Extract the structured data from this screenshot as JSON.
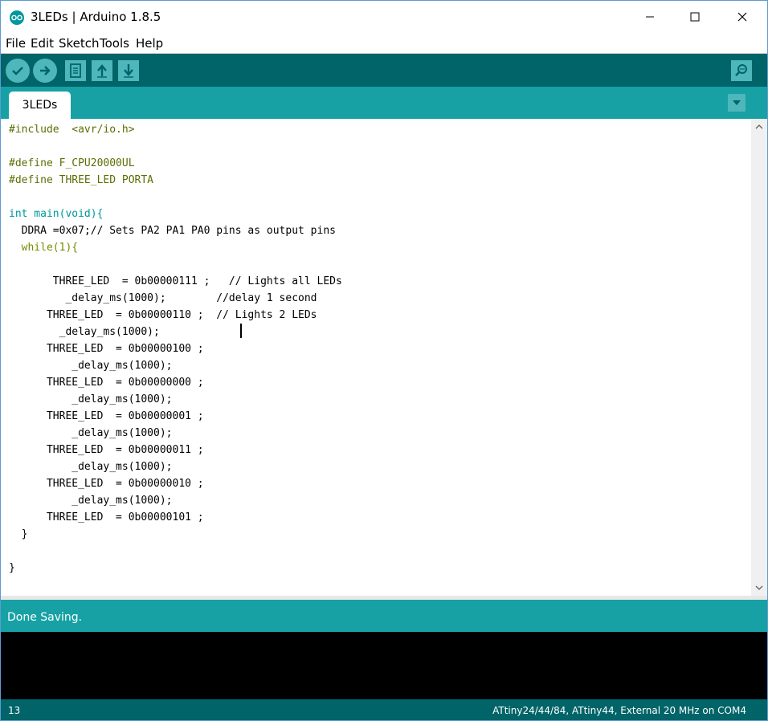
{
  "window": {
    "title": "3LEDs | Arduino 1.8.5",
    "minimize_label": "—",
    "maximize_label": "☐",
    "close_label": "✕"
  },
  "menu": {
    "file": "File",
    "edit": "Edit",
    "sketch": "Sketch",
    "tools": "Tools",
    "help": "Help"
  },
  "toolbar": {
    "buttons": [
      "verify-icon",
      "upload-icon",
      "new-icon",
      "open-icon",
      "save-icon"
    ],
    "right": "serial-monitor-icon"
  },
  "tabs": [
    {
      "label": "3LEDs"
    }
  ],
  "code": [
    "#include  <avr/io.h>",
    "",
    "#define F_CPU20000UL",
    "#define THREE_LED PORTA",
    "",
    "int main(void){",
    "  DDRA =0x07;// Sets PA2 PA1 PA0 pins as output pins",
    "  while(1){",
    "",
    "       THREE_LED  = 0b00000111 ;   // Lights all LEDs",
    "         _delay_ms(1000);        //delay 1 second",
    "      THREE_LED  = 0b00000110 ;  // Lights 2 LEDs",
    "        _delay_ms(1000);",
    "      THREE_LED  = 0b00000100 ;",
    "          _delay_ms(1000);",
    "      THREE_LED  = 0b00000000 ;",
    "          _delay_ms(1000);",
    "      THREE_LED  = 0b00000001 ;",
    "          _delay_ms(1000);",
    "      THREE_LED  = 0b00000011 ;",
    "          _delay_ms(1000);",
    "      THREE_LED  = 0b00000010 ;",
    "          _delay_ms(1000);",
    "      THREE_LED  = 0b00000101 ;",
    "  }",
    "",
    "}"
  ],
  "status": {
    "message": "Done Saving."
  },
  "footer": {
    "line": "13",
    "board": "ATtiny24/44/84, ATtiny44, External 20 MHz on COM4"
  },
  "colors": {
    "toolbar": "#006468",
    "tabbar": "#17a1a5",
    "button": "#4db7bb",
    "keyword": "#728e00",
    "type": "#00979c"
  }
}
